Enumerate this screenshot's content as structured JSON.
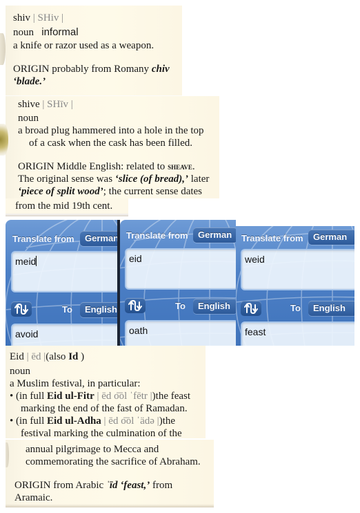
{
  "entries": {
    "shiv": {
      "headword": "shiv",
      "pronunciation": "| SHiv |",
      "pos": "noun",
      "register": "informal",
      "definition": "a knife or razor used as a weapon.",
      "origin_label": "ORIGIN",
      "origin_text": "probably from Romany",
      "origin_word": "chiv",
      "origin_gloss": "‘blade.’"
    },
    "shive": {
      "headword": "shive",
      "pronunciation": "| SHīv |",
      "pos": "noun",
      "definition_line1": "a broad plug hammered into a hole in the top",
      "definition_line2": "of a cask when the cask has been filled.",
      "origin_label": "ORIGIN",
      "origin_line1_text": "Middle English: related to",
      "origin_line1_xref": "sheave",
      "origin_line2_pre": "The original sense was",
      "origin_line2_gloss": "‘slice (of bread),’",
      "origin_line2_post": "later",
      "origin_line3_gloss": "‘piece of split wood’",
      "origin_line3_post": "; the current sense dates",
      "origin_line4": "from the mid 19th cent."
    },
    "eid": {
      "headword": "Eid",
      "pronunciation": "| ēd |",
      "also_pre": "(also",
      "also_word": "Id",
      "also_post": ")",
      "pos": "noun",
      "definition": "a Muslim festival, in particular:",
      "sense1_pre": "• (in full",
      "sense1_term": "Eid ul-Fitr",
      "sense1_pron": "| ēd o͞ol ˈfētr |",
      "sense1_post": ")the feast",
      "sense1_line2": "marking the end of the fast of Ramadan.",
      "sense2_pre": "• (in full",
      "sense2_term": "Eid ul-Adha",
      "sense2_pron": "| ēd o͞ol ˈädə |",
      "sense2_post": ")the",
      "sense2_line2": "festival marking the culmination of the",
      "sense2_line3": "annual pilgrimage to Mecca and",
      "sense2_line4": "commemorating the sacrifice of Abraham.",
      "origin_label": "ORIGIN",
      "origin_text": "from Arabic",
      "origin_word": "ˈīd",
      "origin_gloss": "‘feast,’",
      "origin_post": "from",
      "origin_line2": "Aramaic."
    }
  },
  "translators": [
    {
      "from_label": "Translate from",
      "from_lang": "German",
      "to_label": "To",
      "to_lang": "English",
      "input": "meid",
      "output": "avoid",
      "focused": true
    },
    {
      "from_label": "Translate from",
      "from_lang": "German",
      "to_label": "To",
      "to_lang": "English",
      "input": "eid",
      "output": "oath",
      "focused": false
    },
    {
      "from_label": "Translate from",
      "from_lang": "German",
      "to_label": "To",
      "to_lang": "English",
      "input": "weid",
      "output": "feast",
      "focused": false
    }
  ],
  "icons": {
    "swap": "swap-languages-icon",
    "globe": "globe-background"
  }
}
